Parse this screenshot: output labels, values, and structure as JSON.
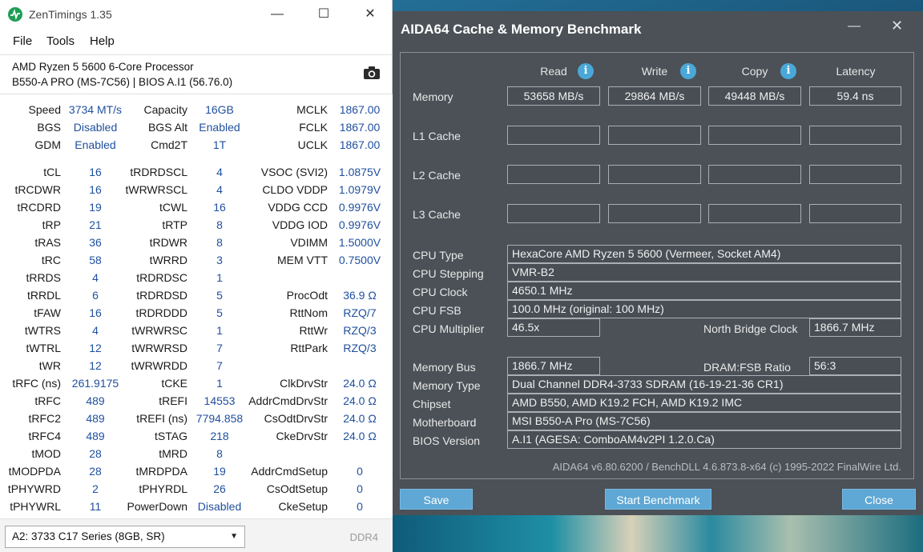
{
  "zentimings": {
    "title": "ZenTimings 1.35",
    "menu": [
      "File",
      "Tools",
      "Help"
    ],
    "processor": "AMD Ryzen 5 5600 6-Core Processor",
    "board": "B550-A PRO (MS-7C56) | BIOS A.I1 (56.76.0)",
    "summary": [
      {
        "label": "Speed",
        "value": "3734 MT/s",
        "label2": "Capacity",
        "value2": "16GB",
        "label3": "MCLK",
        "value3": "1867.00"
      },
      {
        "label": "BGS",
        "value": "Disabled",
        "label2": "BGS Alt",
        "value2": "Enabled",
        "label3": "FCLK",
        "value3": "1867.00"
      },
      {
        "label": "GDM",
        "value": "Enabled",
        "label2": "Cmd2T",
        "value2": "1T",
        "label3": "UCLK",
        "value3": "1867.00"
      }
    ],
    "timings": [
      [
        "tCL",
        "16",
        "tRDRDSCL",
        "4",
        "VSOC (SVI2)",
        "1.0875V"
      ],
      [
        "tRCDWR",
        "16",
        "tWRWRSCL",
        "4",
        "CLDO VDDP",
        "1.0979V"
      ],
      [
        "tRCDRD",
        "19",
        "tCWL",
        "16",
        "VDDG CCD",
        "0.9976V"
      ],
      [
        "tRP",
        "21",
        "tRTP",
        "8",
        "VDDG IOD",
        "0.9976V"
      ],
      [
        "tRAS",
        "36",
        "tRDWR",
        "8",
        "VDIMM",
        "1.5000V"
      ],
      [
        "tRC",
        "58",
        "tWRRD",
        "3",
        "MEM VTT",
        "0.7500V"
      ],
      [
        "tRRDS",
        "4",
        "tRDRDSC",
        "1",
        "",
        ""
      ],
      [
        "tRRDL",
        "6",
        "tRDRDSD",
        "5",
        "ProcOdt",
        "36.9 Ω"
      ],
      [
        "tFAW",
        "16",
        "tRDRDDD",
        "5",
        "RttNom",
        "RZQ/7"
      ],
      [
        "tWTRS",
        "4",
        "tWRWRSC",
        "1",
        "RttWr",
        "RZQ/3"
      ],
      [
        "tWTRL",
        "12",
        "tWRWRSD",
        "7",
        "RttPark",
        "RZQ/3"
      ],
      [
        "tWR",
        "12",
        "tWRWRDD",
        "7",
        "",
        ""
      ],
      [
        "tRFC (ns)",
        "261.9175",
        "tCKE",
        "1",
        "ClkDrvStr",
        "24.0 Ω"
      ],
      [
        "tRFC",
        "489",
        "tREFI",
        "14553",
        "AddrCmdDrvStr",
        "24.0 Ω"
      ],
      [
        "tRFC2",
        "489",
        "tREFI (ns)",
        "7794.858",
        "CsOdtDrvStr",
        "24.0 Ω"
      ],
      [
        "tRFC4",
        "489",
        "tSTAG",
        "218",
        "CkeDrvStr",
        "24.0 Ω"
      ],
      [
        "tMOD",
        "28",
        "tMRD",
        "8",
        "",
        ""
      ],
      [
        "tMODPDA",
        "28",
        "tMRDPDA",
        "19",
        "AddrCmdSetup",
        "0"
      ],
      [
        "tPHYWRD",
        "2",
        "tPHYRDL",
        "26",
        "CsOdtSetup",
        "0"
      ],
      [
        "tPHYWRL",
        "11",
        "PowerDown",
        "Disabled",
        "CkeSetup",
        "0"
      ]
    ],
    "module_select": "A2: 3733 C17 Series (8GB, SR)",
    "memory_type": "DDR4"
  },
  "aida": {
    "title": "AIDA64 Cache & Memory Benchmark",
    "columns": [
      "Read",
      "Write",
      "Copy",
      "Latency"
    ],
    "rows": [
      {
        "label": "Memory",
        "values": [
          "53658 MB/s",
          "29864 MB/s",
          "49448 MB/s",
          "59.4 ns"
        ]
      },
      {
        "label": "L1 Cache",
        "values": [
          "",
          "",
          "",
          ""
        ]
      },
      {
        "label": "L2 Cache",
        "values": [
          "",
          "",
          "",
          ""
        ]
      },
      {
        "label": "L3 Cache",
        "values": [
          "",
          "",
          "",
          ""
        ]
      }
    ],
    "cpu_type_label": "CPU Type",
    "cpu_type": "HexaCore AMD Ryzen 5 5600  (Vermeer, Socket AM4)",
    "cpu_stepping_label": "CPU Stepping",
    "cpu_stepping": "VMR-B2",
    "cpu_clock_label": "CPU Clock",
    "cpu_clock": "4650.1 MHz",
    "cpu_fsb_label": "CPU FSB",
    "cpu_fsb": "100.0 MHz  (original: 100 MHz)",
    "cpu_multiplier_label": "CPU Multiplier",
    "cpu_multiplier": "46.5x",
    "nb_clock_label": "North Bridge Clock",
    "nb_clock": "1866.7 MHz",
    "memory_bus_label": "Memory Bus",
    "memory_bus": "1866.7 MHz",
    "dram_ratio_label": "DRAM:FSB Ratio",
    "dram_ratio": "56:3",
    "memory_type_label": "Memory Type",
    "memory_type": "Dual Channel DDR4-3733 SDRAM  (16-19-21-36 CR1)",
    "chipset_label": "Chipset",
    "chipset": "AMD B550, AMD K19.2 FCH, AMD K19.2 IMC",
    "motherboard_label": "Motherboard",
    "motherboard": "MSI B550-A Pro (MS-7C56)",
    "bios_label": "BIOS Version",
    "bios": "A.I1  (AGESA: ComboAM4v2PI 1.2.0.Ca)",
    "version": "AIDA64 v6.80.6200 / BenchDLL 4.6.873.8-x64  (c) 1995-2022 FinalWire Ltd.",
    "buttons": {
      "save": "Save",
      "start": "Start Benchmark",
      "close": "Close"
    }
  }
}
